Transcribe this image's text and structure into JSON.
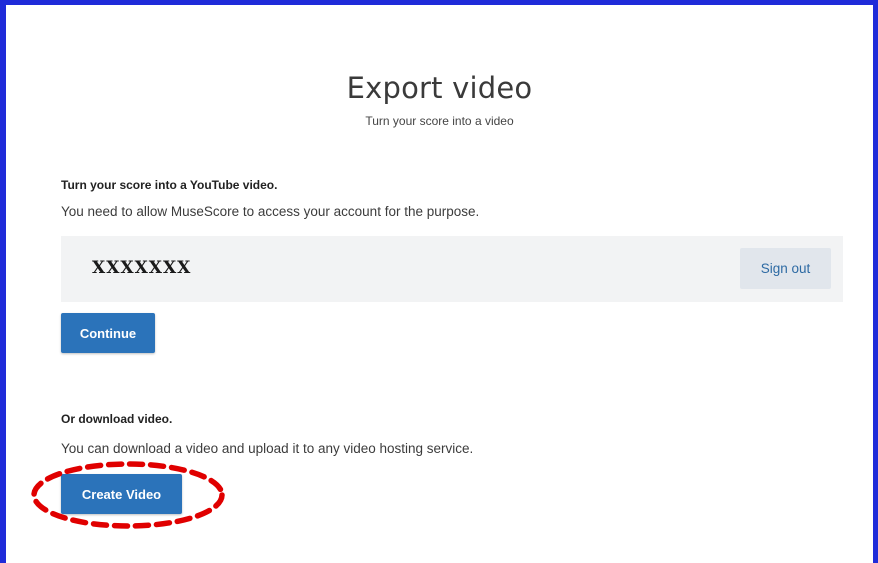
{
  "dialog": {
    "title": "Export video",
    "subtitle": "Turn your score into a video"
  },
  "youtube_section": {
    "heading": "Turn your score into a YouTube video.",
    "description": "You need to allow MuseScore to access your account for the purpose.",
    "account_name": "XXXXXXX",
    "signout_label": "Sign out",
    "continue_label": "Continue"
  },
  "download_section": {
    "heading": "Or download video.",
    "description": "You can download a video and upload it to any video hosting service.",
    "create_label": "Create Video"
  },
  "colors": {
    "frame_border": "#1f2bd9",
    "primary_button": "#2b73ba",
    "annotation": "#e00000"
  }
}
